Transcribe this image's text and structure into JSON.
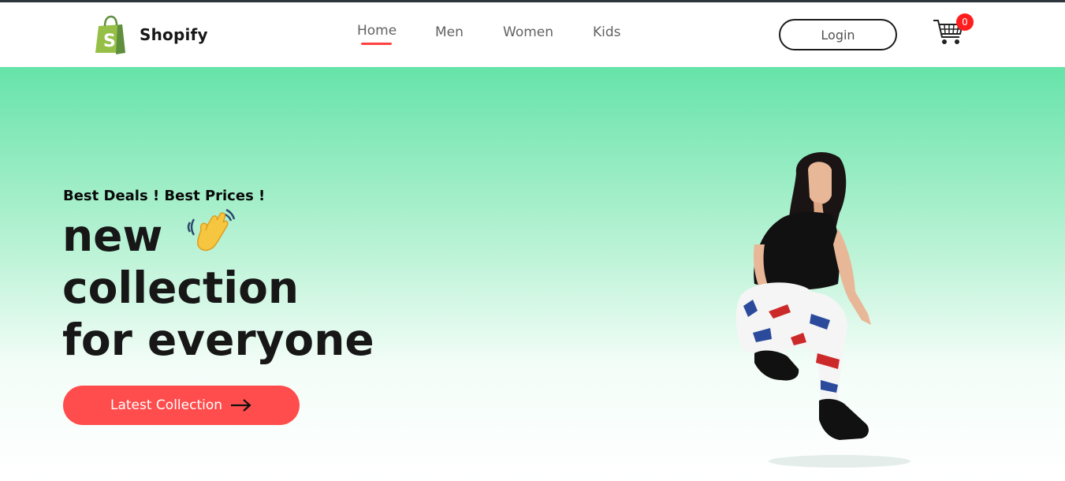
{
  "brand": {
    "name": "Shopify",
    "logo_icon": "shopping-bag-icon",
    "color": "#5e8e3e"
  },
  "nav": {
    "items": [
      {
        "label": "Home",
        "active": true
      },
      {
        "label": "Men",
        "active": false
      },
      {
        "label": "Women",
        "active": false
      },
      {
        "label": "Kids",
        "active": false
      }
    ],
    "active_color": "#ff4141"
  },
  "header": {
    "login_label": "Login",
    "cart_icon": "cart-icon",
    "cart_count": "0"
  },
  "hero": {
    "tagline": "Best Deals ! Best Prices !",
    "headline_lines": [
      "new",
      "collection",
      "for everyone"
    ],
    "headline_icon": "waving-hand-icon",
    "cta_label": "Latest Collection",
    "cta_icon": "arrow-right-icon",
    "cta_color": "#ff4d4d",
    "gradient_top": "#66e3a9",
    "gradient_bottom": "#ffffff",
    "image": "hero-model-image"
  }
}
